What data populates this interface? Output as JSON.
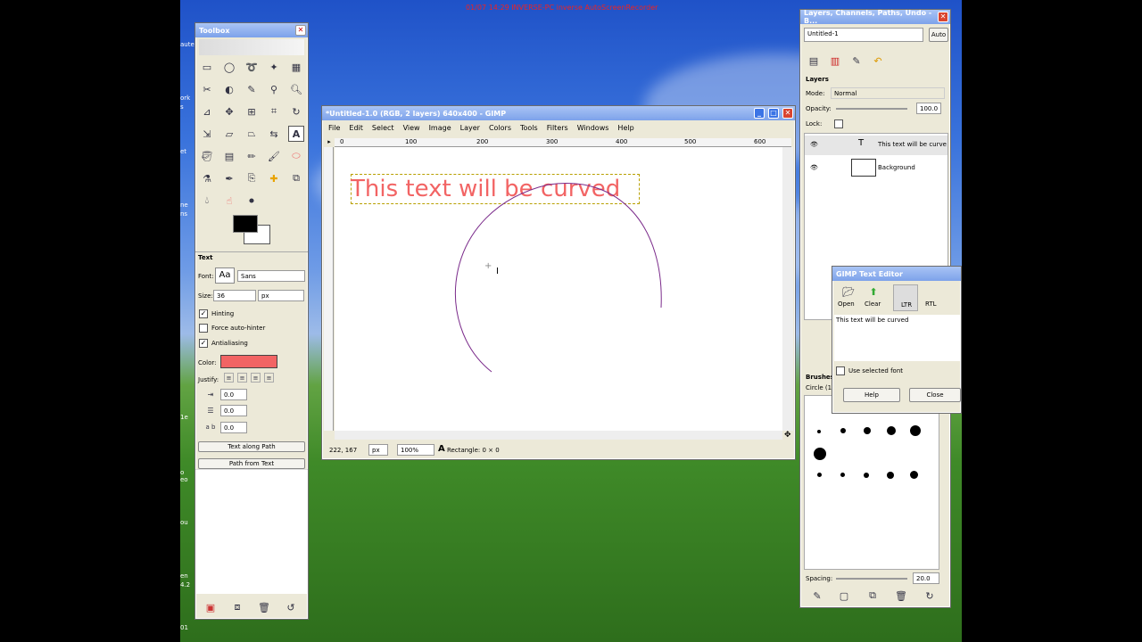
{
  "recorder_text": "01/07 14:29 INVERSE-PC inverse AutoScreenRecorder",
  "desktop_icons": [
    "aute",
    "ork",
    "s",
    "et",
    "ne",
    "ns",
    "1e",
    "11",
    "n",
    "o",
    "eo",
    "ter",
    "ou",
    "en",
    "4.2",
    "01"
  ],
  "toolbox": {
    "title": "Toolbox",
    "tool_options_title": "Text",
    "font_label": "Font:",
    "font_preview": "Aa",
    "font_value": "Sans",
    "size_label": "Size:",
    "size_value": "36",
    "size_unit": "px",
    "hinting": "Hinting",
    "force_autohinter": "Force auto-hinter",
    "antialiasing": "Antialiasing",
    "color_label": "Color:",
    "justify_label": "Justify:",
    "indent_value": "0.0",
    "line_spacing_value": "0.0",
    "letter_spacing_value": "0.0",
    "text_along_path": "Text along Path",
    "path_from_text": "Path from Text",
    "text_color": "#f26464"
  },
  "image_window": {
    "title": "*Untitled-1.0 (RGB, 2 layers) 640x400 - GIMP",
    "menu": [
      "File",
      "Edit",
      "Select",
      "View",
      "Image",
      "Layer",
      "Colors",
      "Tools",
      "Filters",
      "Windows",
      "Help"
    ],
    "ruler_labels": [
      "0",
      "100",
      "200",
      "300",
      "400",
      "500",
      "600"
    ],
    "canvas_text": "This text will be curved",
    "coords": "222, 167",
    "unit": "px",
    "zoom": "100%",
    "status": "Rectangle: 0 × 0"
  },
  "dock": {
    "title": "Layers, Channels, Paths, Undo - B...",
    "image_select": "Untitled-1",
    "auto_button": "Auto",
    "layers_title": "Layers",
    "mode_label": "Mode:",
    "mode_value": "Normal",
    "opacity_label": "Opacity:",
    "opacity_value": "100.0",
    "lock_label": "Lock:",
    "layers": [
      {
        "name": "This text will be curve"
      },
      {
        "name": "Background"
      }
    ],
    "brushes_title": "Brushes",
    "brush_name": "Circle (11",
    "spacing_label": "Spacing:",
    "spacing_value": "20.0"
  },
  "text_editor": {
    "title": "GIMP Text Editor",
    "open": "Open",
    "clear": "Clear",
    "ltr": "LTR",
    "rtl": "RTL",
    "content": "This text will be curved",
    "use_selected_font": "Use selected font",
    "help": "Help",
    "close": "Close"
  }
}
